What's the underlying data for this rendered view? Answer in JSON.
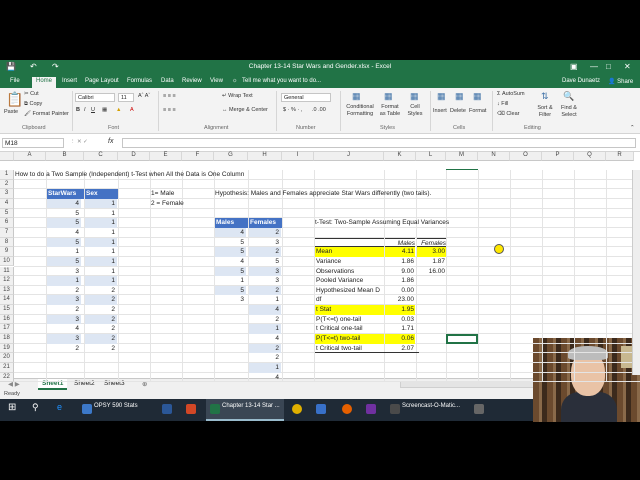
{
  "window": {
    "title": "Chapter 13-14 Star Wars and Gender.xlsx - Excel",
    "user": "Dave Dunaetz",
    "share": "Share",
    "tell_me": "Tell me what you want to do..."
  },
  "ribbon_tabs": [
    "File",
    "Home",
    "Insert",
    "Page Layout",
    "Formulas",
    "Data",
    "Review",
    "View"
  ],
  "ribbon": {
    "clipboard": {
      "paste": "Paste",
      "cut": "Cut",
      "copy": "Copy",
      "format_painter": "Format Painter",
      "group": "Clipboard"
    },
    "font": {
      "name": "Calibri",
      "size": "11",
      "group": "Font"
    },
    "alignment": {
      "wrap": "Wrap Text",
      "merge": "Merge & Center",
      "group": "Alignment"
    },
    "number": {
      "format": "General",
      "group": "Number"
    },
    "styles": {
      "conditional": "Conditional Formatting",
      "format_table": "Format as Table",
      "cell_styles": "Cell Styles",
      "group": "Styles"
    },
    "cells": {
      "insert": "Insert",
      "delete": "Delete",
      "format": "Format",
      "group": "Cells"
    },
    "editing": {
      "autosum": "AutoSum",
      "fill": "Fill",
      "clear": "Clear",
      "sort": "Sort & Filter",
      "find": "Find & Select",
      "group": "Editing"
    }
  },
  "formula_bar": {
    "name_box": "M18",
    "fx": "fx",
    "value": ""
  },
  "columns": [
    "A",
    "B",
    "C",
    "D",
    "E",
    "F",
    "G",
    "H",
    "I",
    "J",
    "K",
    "L",
    "M",
    "N",
    "O",
    "P",
    "Q",
    "R"
  ],
  "rows": [
    "1",
    "2",
    "3",
    "4",
    "5",
    "6",
    "7",
    "8",
    "9",
    "10",
    "11",
    "12",
    "13",
    "14",
    "15",
    "16",
    "17",
    "18",
    "19",
    "20",
    "21",
    "22"
  ],
  "cells": {
    "a1": "How to do a Two Sample (Independent) t-Test when All the Data is One Column",
    "b3": "StarWars",
    "c3": "Sex",
    "e3": "1= Male",
    "e4": "2 = Female",
    "g3": "Hypothesis: Males and Females appreciate Star Wars differently (two tails).",
    "g6": "Males",
    "h6": "Females",
    "j6": "t-Test: Two-Sample Assuming Equal Variances"
  },
  "starwars": [
    "4",
    "5",
    "5",
    "4",
    "5",
    "1",
    "5",
    "3",
    "1",
    "2",
    "3",
    "2",
    "3",
    "4",
    "3",
    "2"
  ],
  "sex": [
    "1",
    "1",
    "1",
    "1",
    "1",
    "1",
    "1",
    "1",
    "1",
    "2",
    "2",
    "2",
    "2",
    "2",
    "2",
    "2"
  ],
  "males": [
    "4",
    "5",
    "5",
    "4",
    "5",
    "1",
    "5",
    "3"
  ],
  "females": [
    "2",
    "3",
    "2",
    "5",
    "3",
    "3",
    "2",
    "1",
    "4",
    "2",
    "1",
    "4",
    "2",
    "2",
    "1",
    "4"
  ],
  "ttest": {
    "header": [
      "",
      "Males",
      "Females"
    ],
    "rows": [
      [
        "Mean",
        "4.11",
        "3.00"
      ],
      [
        "Variance",
        "1.86",
        "1.87"
      ],
      [
        "Observations",
        "9.00",
        "16.00"
      ],
      [
        "Pooled Variance",
        "1.86",
        ""
      ],
      [
        "Hypothesized Mean D",
        "0.00",
        ""
      ],
      [
        "df",
        "23.00",
        ""
      ],
      [
        "t Stat",
        "1.95",
        ""
      ],
      [
        "P(T<=t) one-tail",
        "0.03",
        ""
      ],
      [
        "t Critical one-tail",
        "1.71",
        ""
      ],
      [
        "P(T<=t) two-tail",
        "0.06",
        ""
      ],
      [
        "t Critical two-tail",
        "2.07",
        ""
      ]
    ]
  },
  "sheets": [
    "Sheet1",
    "Sheet2",
    "Sheet3"
  ],
  "status": "Ready",
  "taskbar": {
    "items": [
      "OPSY 590 Stats",
      "Chapter 13-14 Star ...",
      "Screencast-O-Matic..."
    ]
  },
  "colors": {
    "excel_green": "#217346",
    "highlight": "#ffff00",
    "table_header": "#4472c4",
    "table_band": "#dde6f3"
  }
}
